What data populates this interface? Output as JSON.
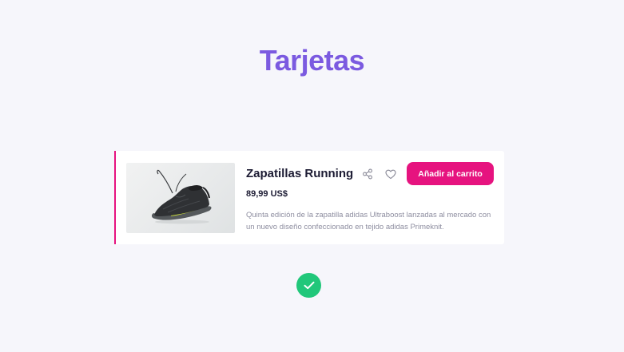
{
  "page": {
    "title": "Tarjetas"
  },
  "card": {
    "image_alt": "Zapatillas Running",
    "title": "Zapatillas Running",
    "price": "89,99 US$",
    "description": "Quinta edición de la zapatilla adidas Ultraboost lanzadas al mercado con un nuevo diseño confeccionado en tejido adidas Primeknit.",
    "add_to_cart_label": "Añadir al carrito",
    "share_icon": "share-icon",
    "like_icon": "heart-icon"
  },
  "status": {
    "icon": "check-icon"
  },
  "colors": {
    "title": "#7b5ae0",
    "accent": "#e6137f",
    "success": "#21c77a",
    "text_dark": "#1c1b33",
    "text_muted": "#8e8ea0",
    "background": "#f6f6fb"
  }
}
